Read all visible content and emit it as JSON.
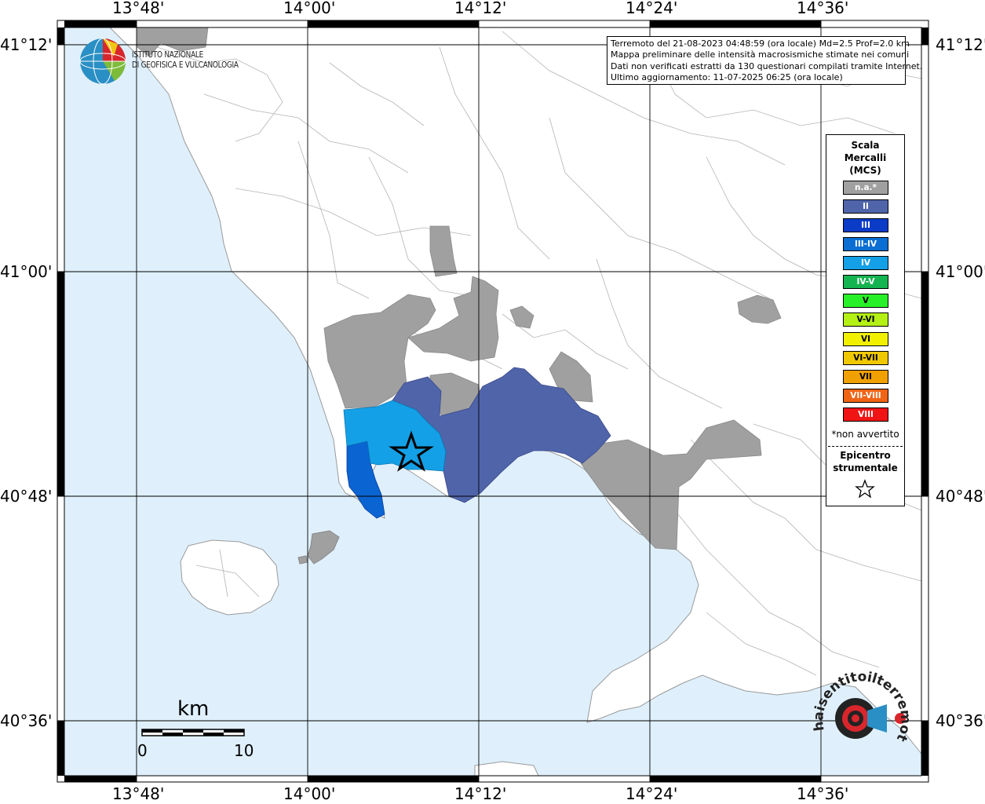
{
  "map": {
    "longitude_labels": [
      "13°48'",
      "14°00'",
      "14°12'",
      "14°24'",
      "14°36'"
    ],
    "latitude_labels": [
      "41°12'",
      "41°00'",
      "40°48'",
      "40°36'"
    ]
  },
  "organization": {
    "line1": "ISTITUTO NAZIONALE",
    "line2": "DI GEOFISICA E VULCANOLOGIA"
  },
  "info": {
    "line1": "Terremoto del 21-08-2023 04:48:59 (ora locale) Md=2.5 Prof=2.0 km",
    "line2": "Mappa preliminare delle intensità macrosismiche stimate nei comuni",
    "line3": "Dati non verificati estratti da 130 questionari compilati tramite Internet.",
    "line4": "Ultimo aggiornamento: 11-07-2025 06:25 (ora locale)"
  },
  "legend": {
    "title_line1": "Scala",
    "title_line2": "Mercalli",
    "title_line3": "(MCS)",
    "items": [
      {
        "label": "n.a.*",
        "color": "#a0a0a0"
      },
      {
        "label": "II",
        "color": "#5064aa"
      },
      {
        "label": "III",
        "color": "#0a3cc8"
      },
      {
        "label": "III-IV",
        "color": "#0a6ed2"
      },
      {
        "label": "IV",
        "color": "#14a0e6"
      },
      {
        "label": "IV-V",
        "color": "#14b450"
      },
      {
        "label": "V",
        "color": "#28f028"
      },
      {
        "label": "V-VI",
        "color": "#b4f014"
      },
      {
        "label": "VI",
        "color": "#f0f000"
      },
      {
        "label": "VI-VII",
        "color": "#f0c800"
      },
      {
        "label": "VII",
        "color": "#f0a000"
      },
      {
        "label": "VII-VIII",
        "color": "#f06414"
      },
      {
        "label": "VIII",
        "color": "#f01414"
      }
    ],
    "note": "*non avvertito",
    "epicenter_line1": "Epicentro",
    "epicenter_line2": "strumentale"
  },
  "scale_bar": {
    "unit": "km",
    "min_label": "0",
    "max_label": "10"
  },
  "watermark": {
    "text": "haisentitoilterremoto.it · www."
  },
  "colors": {
    "sea": "#dff0fc",
    "land": "#ffffff",
    "boundary": "#b4b4b4",
    "not_available": "#a0a0a0",
    "intensity_II": "#5064aa",
    "intensity_III": "#0a64d2",
    "intensity_IV": "#14a0e6"
  }
}
